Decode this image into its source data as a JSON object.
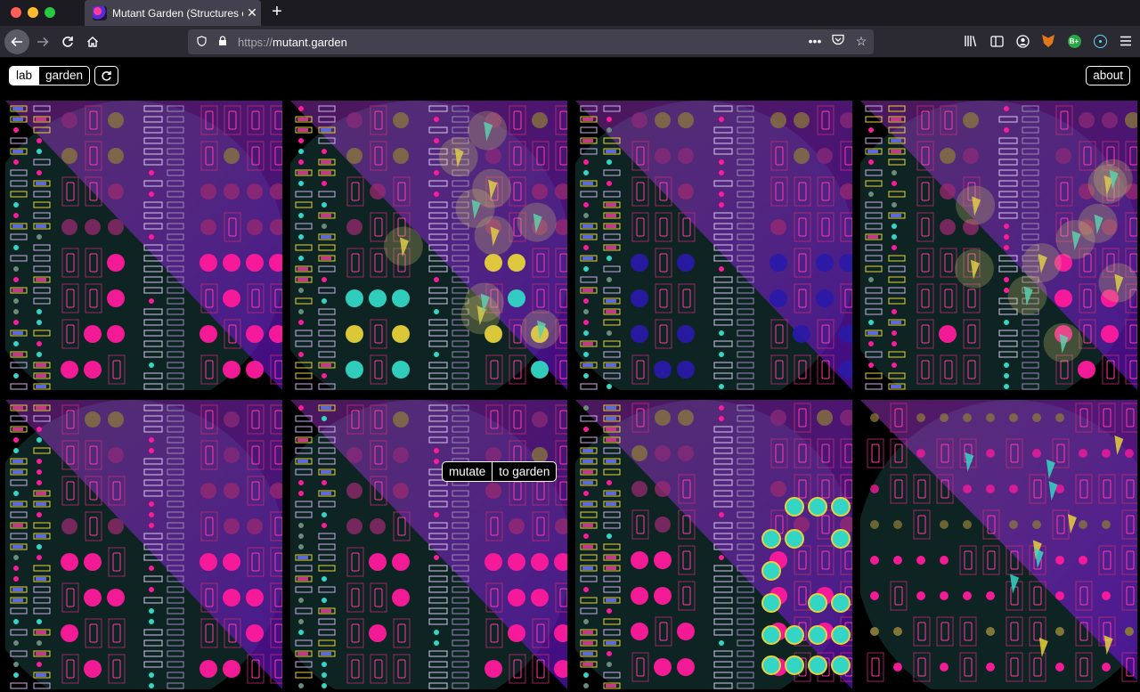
{
  "browser": {
    "tab_title": "Mutant Garden (Structures of R",
    "url_scheme": "https://",
    "url_host": "mutant.garden",
    "new_tab_label": "+",
    "icons": [
      "back-arrow-icon",
      "forward-arrow-icon",
      "reload-icon",
      "home-icon",
      "shield-icon",
      "lock-icon",
      "more-dots-icon",
      "pocket-icon",
      "bookmark-star-icon",
      "library-icon",
      "sidebar-icon",
      "account-icon",
      "metamask-fox-icon",
      "extension-b-icon",
      "react-devtools-icon",
      "menu-icon"
    ]
  },
  "toolbar": {
    "lab_label": "lab",
    "garden_label": "garden",
    "refresh_icon": "refresh-icon",
    "about_label": "about"
  },
  "tile_actions": {
    "mutate_label": "mutate",
    "to_garden_label": "to garden"
  },
  "colors": {
    "accent_magenta": "#ff1a9c",
    "accent_purple": "#7a1fd6",
    "accent_cyan": "#33d6c5",
    "accent_yellow": "#e6d23a",
    "dark_teal": "#0f2a28"
  },
  "tiles": [
    {
      "variant": "a"
    },
    {
      "variant": "b"
    },
    {
      "variant": "c"
    },
    {
      "variant": "d"
    },
    {
      "variant": "e"
    },
    {
      "variant": "f"
    },
    {
      "variant": "g"
    },
    {
      "variant": "h"
    }
  ]
}
